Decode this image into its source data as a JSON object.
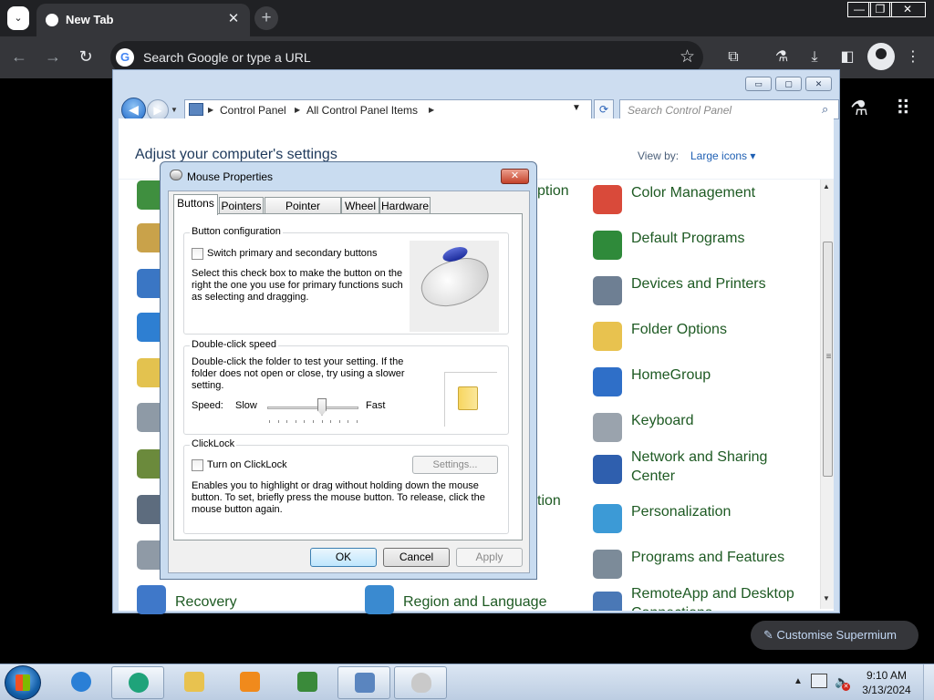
{
  "browser": {
    "tab_title": "New Tab",
    "tab_close": "✕",
    "new_tab": "+",
    "tab_search": "⌄",
    "window_min": "—",
    "window_restore": "❐",
    "window_close": "✕",
    "back": "←",
    "forward": "→",
    "reload": "↻",
    "omnibox_placeholder": "Search Google or type a URL",
    "google_letter": "G",
    "bookmark": "☆",
    "extensions_icon": "⧉",
    "labs_icon": "⚗",
    "download_icon": "⤓",
    "side_panel_icon": "◧",
    "menu_icon": "⋮",
    "side_labs_icon": "⚗",
    "apps_icon": "⠿",
    "customise_label": "✎  Customise Supermium"
  },
  "control_panel": {
    "window_buttons": [
      "▭",
      "▢",
      "✕"
    ],
    "back": "◀",
    "forward": "▶",
    "breadcrumb": [
      "Control Panel",
      "All Control Panel Items"
    ],
    "chevron": "▶",
    "dropdown": "▼",
    "refresh": "⟳",
    "search_placeholder": "Search Control Panel",
    "search_icon": "⌕",
    "heading": "Adjust your computer's settings",
    "view_by_label": "View by:",
    "view_by_value": "Large icons ▾",
    "scroll_up": "▲",
    "scroll_grip": "≡",
    "scroll_down": "▼",
    "right_column": [
      {
        "label": "Color Management",
        "color": "#d94a3a"
      },
      {
        "label": "Default Programs",
        "color": "#2f8a3a"
      },
      {
        "label": "Devices and Printers",
        "color": "#6e7f93"
      },
      {
        "label": "Folder Options",
        "color": "#e8c24f"
      },
      {
        "label": "HomeGroup",
        "color": "#2f6fc8"
      },
      {
        "label": "Keyboard",
        "color": "#9aa3ad"
      },
      {
        "label": "Network and Sharing Center",
        "color": "#2f5fae"
      },
      {
        "label": "Personalization",
        "color": "#3c9ad6"
      },
      {
        "label": "Programs and Features",
        "color": "#7c8b99"
      },
      {
        "label": "RemoteApp and Desktop Connections",
        "color": "#4a78b6"
      }
    ],
    "middle_partials": [
      "ption",
      "tion"
    ],
    "bottom_row": [
      "Recovery",
      "Region and Language"
    ]
  },
  "mouse_dialog": {
    "title": "Mouse Properties",
    "close": "✕",
    "tabs": [
      "Buttons",
      "Pointers",
      "Pointer Options",
      "Wheel",
      "Hardware"
    ],
    "button_config": {
      "title": "Button configuration",
      "checkbox_label": "Switch primary and secondary buttons",
      "description": "Select this check box to make the button on the right the one you use for primary functions such as selecting and dragging."
    },
    "double_click": {
      "title": "Double-click speed",
      "description": "Double-click the folder to test your setting. If the folder does not open or close, try using a slower setting.",
      "speed_label": "Speed:",
      "slow_label": "Slow",
      "fast_label": "Fast",
      "speed_value": 0.6
    },
    "clicklock": {
      "title": "ClickLock",
      "checkbox_label": "Turn on ClickLock",
      "settings_button": "Settings...",
      "description": "Enables you to highlight or drag without holding down the mouse button. To set, briefly press the mouse button. To release, click the mouse button again."
    },
    "buttons": {
      "ok": "OK",
      "cancel": "Cancel",
      "apply": "Apply"
    }
  },
  "taskbar": {
    "clock_time": "9:10 AM",
    "clock_date": "3/13/2024",
    "tray_up": "▲",
    "volume": "🔈",
    "volume_x": "✕",
    "pinned": [
      {
        "name": "internet-explorer",
        "color": "#2a7fd6"
      },
      {
        "name": "app-green-circle",
        "color": "#1fa37a"
      },
      {
        "name": "windows-explorer",
        "color": "#e8c24f"
      },
      {
        "name": "media-player",
        "color": "#f08a1c"
      },
      {
        "name": "users-app",
        "color": "#3a8a3a"
      },
      {
        "name": "control-panel",
        "color": "#5a85bf"
      },
      {
        "name": "mouse-properties",
        "color": "#c9c9c9"
      }
    ]
  }
}
